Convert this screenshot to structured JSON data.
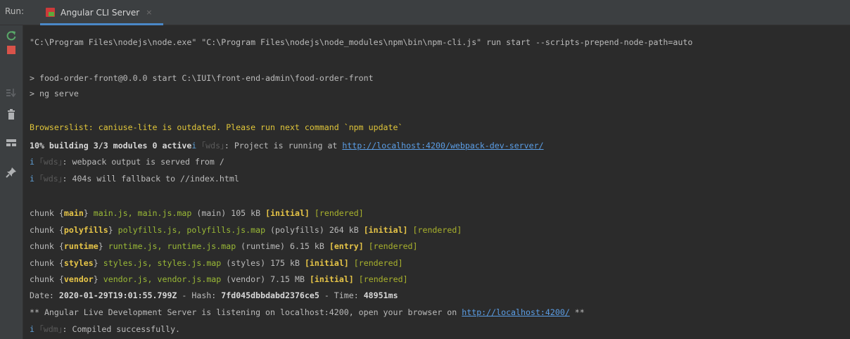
{
  "run_bar": {
    "label": "Run:",
    "tab_title": "Angular CLI Server",
    "tab_close": "×"
  },
  "toolbar": {
    "icons": [
      "rerun-icon",
      "stop-icon",
      "scroll-to-end-icon",
      "delete-icon",
      "layout-icon",
      "pin-icon"
    ]
  },
  "console": {
    "command": "\"C:\\Program Files\\nodejs\\node.exe\" \"C:\\Program Files\\nodejs\\node_modules\\npm\\bin\\npm-cli.js\" run start --scripts-prepend-node-path=auto",
    "start_line": "> food-order-front@0.0.0 start C:\\IUI\\front-end-admin\\food-order-front",
    "serve_line": "> ng serve",
    "browserslist": "Browserslist: caniuse-lite is outdated. Please run next command `npm update`",
    "building": {
      "progress": "10% building 3/3 modules 0 active",
      "prefix": "i",
      "tag": "｢wds｣",
      "text": ": Project is running at ",
      "url": "http://localhost:4200/webpack-dev-server/"
    },
    "wds1": {
      "prefix": "i",
      "tag": "｢wds｣",
      "text": ": webpack output is served from /"
    },
    "wds2": {
      "prefix": "i",
      "tag": "｢wds｣",
      "text": ": 404s will fallback to //index.html"
    },
    "chunks": [
      {
        "prefix": "chunk {",
        "name": "main",
        "suffix": "} ",
        "files": "main.js, main.js.map",
        "group": " (main) ",
        "size": "105 kB",
        "flag": "[initial]",
        "status": "[rendered]"
      },
      {
        "prefix": "chunk {",
        "name": "polyfills",
        "suffix": "} ",
        "files": "polyfills.js, polyfills.js.map",
        "group": " (polyfills) ",
        "size": "264 kB",
        "flag": "[initial]",
        "status": "[rendered]"
      },
      {
        "prefix": "chunk {",
        "name": "runtime",
        "suffix": "} ",
        "files": "runtime.js, runtime.js.map",
        "group": " (runtime) ",
        "size": "6.15 kB",
        "flag": "[entry]",
        "status": "[rendered]"
      },
      {
        "prefix": "chunk {",
        "name": "styles",
        "suffix": "} ",
        "files": "styles.js, styles.js.map",
        "group": " (styles) ",
        "size": "175 kB",
        "flag": "[initial]",
        "status": "[rendered]"
      },
      {
        "prefix": "chunk {",
        "name": "vendor",
        "suffix": "} ",
        "files": "vendor.js, vendor.js.map",
        "group": " (vendor) ",
        "size": "7.15 MB",
        "flag": "[initial]",
        "status": "[rendered]"
      }
    ],
    "date_line": {
      "date_label": "Date: ",
      "date": "2020-01-29T19:01:55.799Z",
      "hash_label": " - Hash: ",
      "hash": "7fd045dbbdabd2376ce5",
      "time_label": " - Time: ",
      "time": "48951ms"
    },
    "live_line": {
      "text": "** Angular Live Development Server is listening on localhost:4200, open your browser on ",
      "url": "http://localhost:4200/",
      "suffix": " **"
    },
    "compiled": {
      "prefix": "i",
      "tag": "｢wdm｣",
      "text": ": Compiled successfully."
    }
  },
  "colors": {
    "background": "#2b2b2b",
    "toolbar_bg": "#3c3f41",
    "accent_tab": "#4a88c7",
    "warning_yellow": "#dfc53a",
    "link_blue": "#5b9ee6"
  }
}
